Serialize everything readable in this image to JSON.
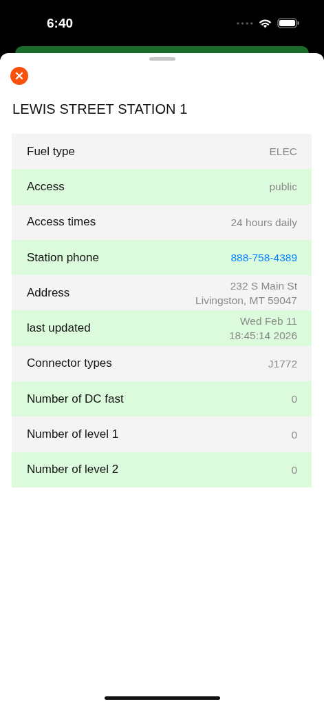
{
  "status_bar": {
    "time": "6:40"
  },
  "sheet": {
    "title": "LEWIS STREET STATION 1"
  },
  "rows": [
    {
      "label": "Fuel type",
      "value": "ELEC",
      "kind": "text"
    },
    {
      "label": "Access",
      "value": "public",
      "kind": "text"
    },
    {
      "label": "Access times",
      "value": "24 hours daily",
      "kind": "text"
    },
    {
      "label": "Station phone",
      "value": "888-758-4389",
      "kind": "link"
    },
    {
      "label": "Address",
      "value": "232 S Main St\nLivingston, MT 59047",
      "kind": "text"
    },
    {
      "label": "last updated",
      "value": "Wed Feb 11\n18:45:14 2026",
      "kind": "text"
    },
    {
      "label": "Connector types",
      "value": "J1772",
      "kind": "text"
    },
    {
      "label": "Number of DC fast",
      "value": "0",
      "kind": "text"
    },
    {
      "label": "Number of level 1",
      "value": "0",
      "kind": "text"
    },
    {
      "label": "Number of level 2",
      "value": "0",
      "kind": "text"
    }
  ]
}
